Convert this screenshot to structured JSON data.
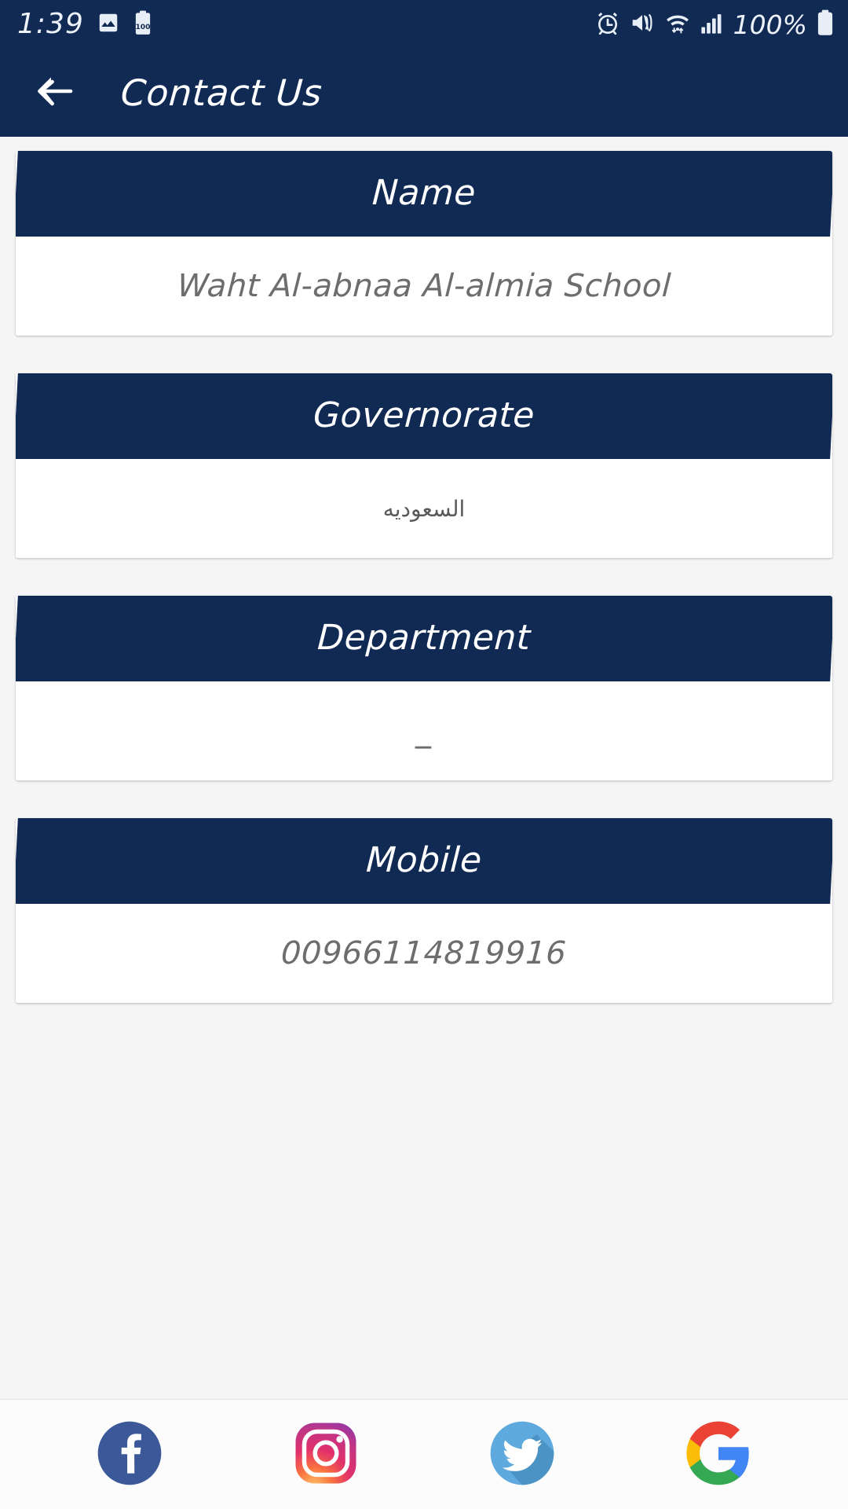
{
  "status_bar": {
    "time": "1:39",
    "battery_percent": "100%",
    "left_icons": [
      "image-icon",
      "battery-saver-100-icon"
    ],
    "right_icons": [
      "alarm-icon",
      "vibrate-icon",
      "wifi-icon",
      "signal-bars-icon",
      "battery-icon"
    ]
  },
  "app_bar": {
    "back_icon": "arrow-left-icon",
    "title": "Contact Us"
  },
  "cards": [
    {
      "id": "name",
      "header": "Name",
      "value": "Waht Al-abnaa Al-almia School",
      "rtl": false
    },
    {
      "id": "governorate",
      "header": "Governorate",
      "value": "السعوديه",
      "rtl": true
    },
    {
      "id": "department",
      "header": "Department",
      "value": "_",
      "rtl": false
    },
    {
      "id": "mobile",
      "header": "Mobile",
      "value": "00966114819916",
      "rtl": false
    }
  ],
  "social": [
    {
      "name": "facebook",
      "label": "Facebook",
      "color": "#3b5998"
    },
    {
      "name": "instagram",
      "label": "Instagram",
      "color": "#d6249f"
    },
    {
      "name": "twitter",
      "label": "Twitter",
      "color": "#55a8e0"
    },
    {
      "name": "google",
      "label": "Google",
      "color": "#4285f4"
    }
  ],
  "theme": {
    "primary": "#102a54",
    "card_bg": "#ffffff",
    "page_bg": "#f5f5f5",
    "value_text": "#6d6d6d"
  }
}
